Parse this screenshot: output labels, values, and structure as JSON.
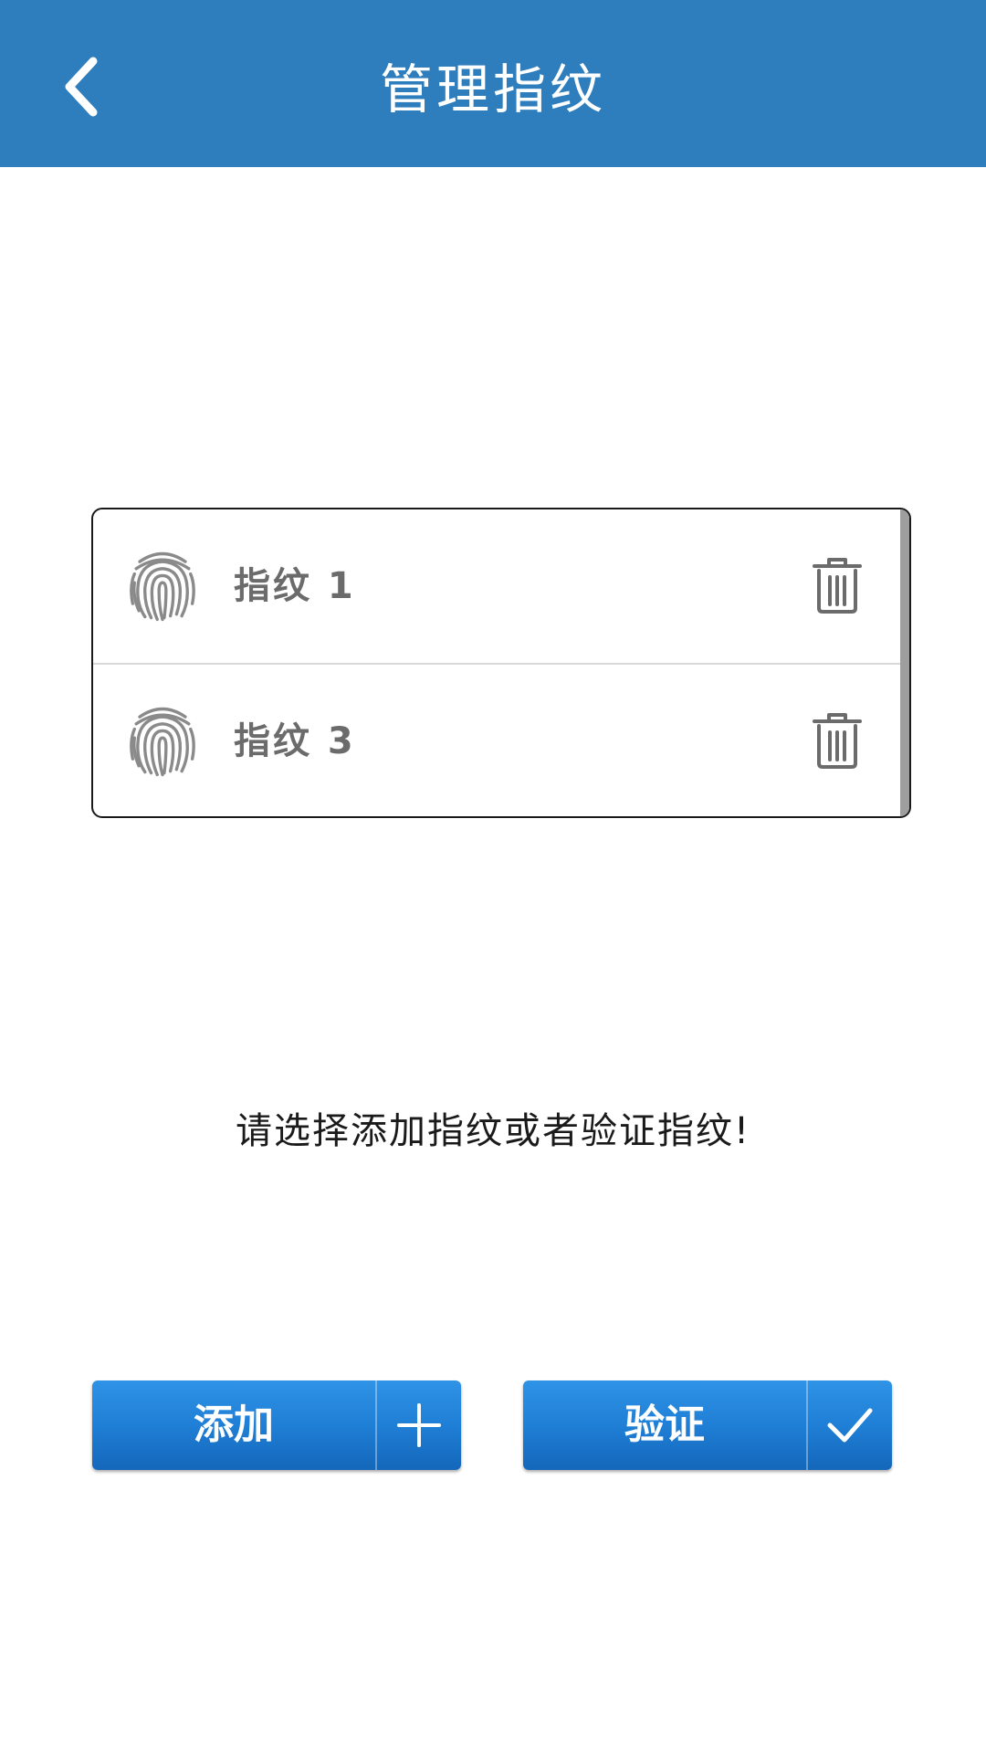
{
  "header": {
    "title": "管理指纹",
    "back_icon": "chevron-left-icon"
  },
  "fingerprints": [
    {
      "label": "指纹 1",
      "icon": "fingerprint-icon",
      "action_icon": "trash-icon"
    },
    {
      "label": "指纹 3",
      "icon": "fingerprint-icon",
      "action_icon": "trash-icon"
    }
  ],
  "prompt": "请选择添加指纹或者验证指纹!",
  "buttons": {
    "add_label": "添加",
    "add_icon": "plus-icon",
    "verify_label": "验证",
    "verify_icon": "check-icon"
  },
  "colors": {
    "header_bg": "#2e7dbd",
    "button_blue": "#1f7fd6",
    "text_gray": "#6b6b6b"
  }
}
